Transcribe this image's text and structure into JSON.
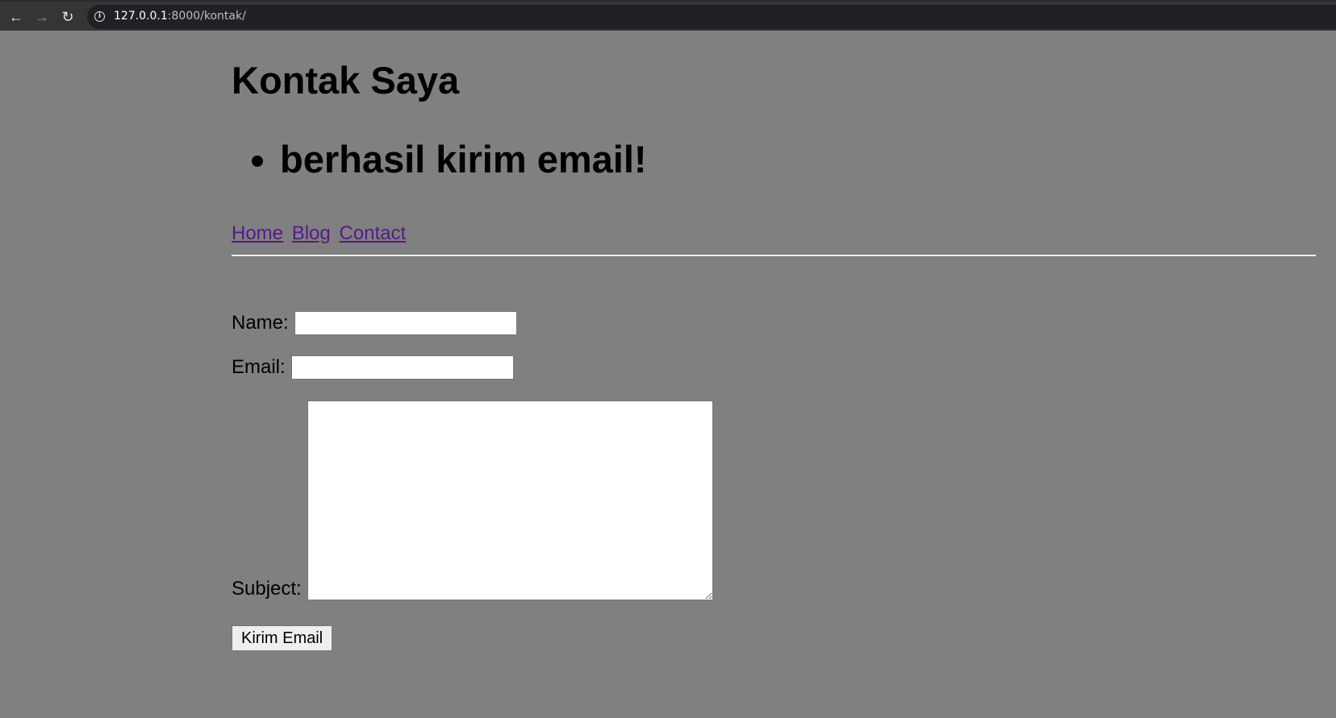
{
  "browser": {
    "url_host": "127.0.0.1",
    "url_rest": ":8000/kontak/"
  },
  "page": {
    "title": "Kontak Saya",
    "messages": [
      "berhasil kirim email!"
    ],
    "nav": {
      "home": "Home",
      "blog": "Blog",
      "contact": "Contact"
    },
    "form": {
      "name_label": "Name:",
      "name_value": "",
      "email_label": "Email:",
      "email_value": "",
      "subject_label": "Subject:",
      "subject_value": "",
      "submit_label": "Kirim Email"
    }
  },
  "colors": {
    "background": "#808080",
    "link_visited": "#551a8b"
  }
}
